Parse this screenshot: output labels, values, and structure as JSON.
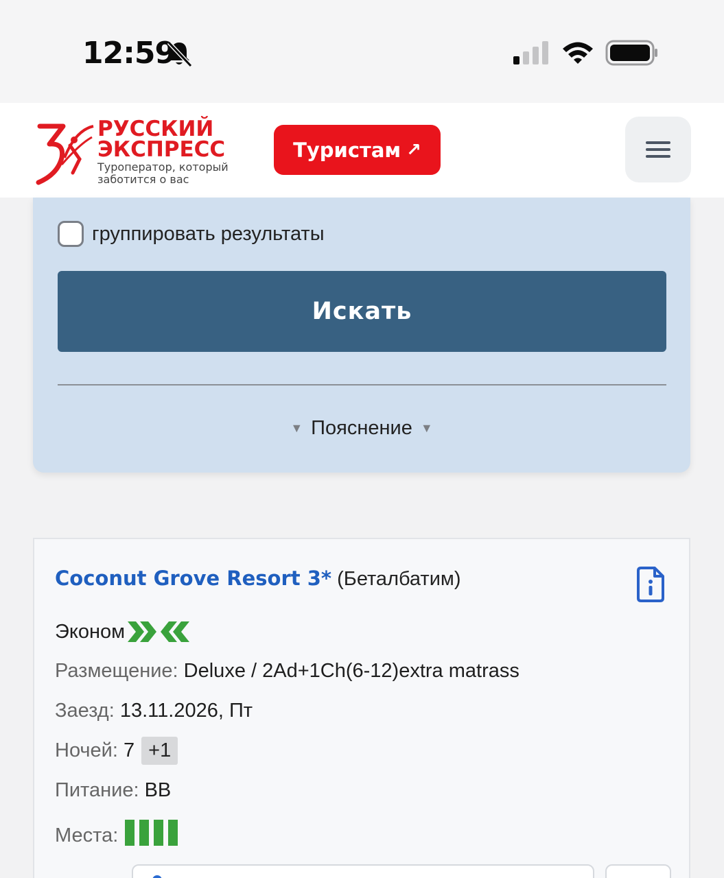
{
  "status_bar": {
    "time": "12:59",
    "icons": [
      "bell-slash-icon",
      "cellular-signal-icon",
      "wifi-icon",
      "battery-icon"
    ]
  },
  "header": {
    "logo": {
      "line1": "РУССКИЙ",
      "line2": "ЭКСПРЕСС",
      "tagline1": "Туроператор, который",
      "tagline2": "заботится о вас"
    },
    "tourists_button": "Туристам",
    "tourists_arrow": "↗",
    "menu_icon": "hamburger-menu-icon"
  },
  "search_panel": {
    "group_results_label": "группировать результаты",
    "group_results_checked": false,
    "search_button": "Искать",
    "explanation_label": "Пояснение"
  },
  "result": {
    "hotel_name": "Coconut Grove Resort 3*",
    "hotel_location": "(Беталбатим)",
    "category": "Эконом",
    "room_label": "Размещение:",
    "room_value": "Deluxe / 2Ad+1Ch(6-12)extra matrass",
    "checkin_label": "Заезд:",
    "checkin_value": "13.11.2026, Пт",
    "nights_label": "Ночей:",
    "nights_value": "7",
    "nights_extra": "+1",
    "meal_label": "Питание:",
    "meal_value": "BB",
    "places_label": "Места:",
    "places_level": 4
  },
  "colors": {
    "brand_red": "#e9141c",
    "search_button": "#386182",
    "panel_bg": "#d0dfef",
    "hotel_link": "#1f5fbf",
    "availability_green": "#3aa23c"
  }
}
